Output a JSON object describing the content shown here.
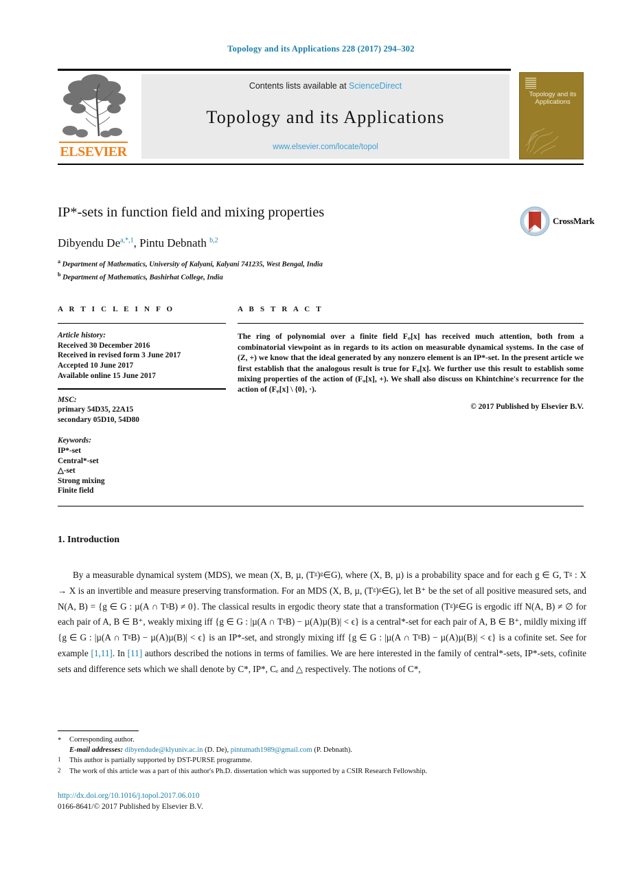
{
  "running_head": "Topology and its Applications 228 (2017) 294–302",
  "masthead": {
    "contents_prefix": "Contents lists available at ",
    "sciencedirect": "ScienceDirect",
    "journal_title": "Topology  and  its  Applications",
    "journal_url": "www.elsevier.com/locate/topol",
    "publisher_wordmark": "ELSEVIER",
    "cover_title": "Topology and its Applications"
  },
  "article": {
    "title": "IP*-sets in function field and mixing properties",
    "authors_line": "Dibyendu De",
    "author1_sups": "a,*,1",
    "author2_name": ", Pintu Debnath ",
    "author2_sups": "b,2",
    "affiliations": [
      {
        "mark": "a",
        "text": "Department of Mathematics, University of Kalyani, Kalyani 741235, West Bengal, India"
      },
      {
        "mark": "b",
        "text": "Department of Mathematics, Bashirhat College, India"
      }
    ],
    "crossmark_label": "CrossMark"
  },
  "info": {
    "heading": "A R T I C L E   I N F O",
    "history_label": "Article history:",
    "history": [
      "Received 30 December 2016",
      "Received in revised form 3 June 2017",
      "Accepted 10 June 2017",
      "Available online 15 June 2017"
    ],
    "msc_label": "MSC:",
    "msc": [
      "primary 54D35, 22A15",
      "secondary 05D10, 54D80"
    ],
    "keywords_label": "Keywords:",
    "keywords": [
      "IP*-set",
      "Central*-set",
      "△-set",
      "Strong mixing",
      "Finite field"
    ]
  },
  "abstract": {
    "heading": "A B S T R A C T",
    "body": "The ring of polynomial over a finite field Fᵩ[x] has received much attention, both from a combinatorial viewpoint as in regards to its action on measurable dynamical systems. In the case of (Z, +) we know that the ideal generated by any nonzero element is an IP*-set. In the present article we first establish that the analogous result is true for Fᵩ[x]. We further use this result to establish some mixing properties of the action of (Fᵩ[x], +). We shall also discuss on Khintchine's recurrence for the action of (Fᵩ[x] \\ {0}, ·).",
    "copyright": "© 2017 Published by Elsevier B.V."
  },
  "section": {
    "heading": "1.  Introduction",
    "paragraph_1": "By a measurable dynamical system (MDS), we mean (X, B, µ, (Tᵍ)ᵍ∈G), where (X, B, µ) is a probability space and for each g ∈ G, Tᵍ : X → X is an invertible and measure preserving transformation. For an MDS (X, B, µ, (Tᵍ)ᵍ∈G), let B⁺ be the set of all positive measured sets, and N(A, B) = {g ∈ G : µ(A ∩ TᵍB) ≠ 0}. The classical results in ergodic theory state that a transformation (Tᵍ)ᵍ∈G is ergodic iff N(A, B) ≠ ∅ for each pair of A, B ∈ B⁺, weakly mixing iff {g ∈ G : |µ(A ∩ TᵍB) − µ(A)µ(B)| < ϵ} is a central*-set for each pair of A, B ∈ B⁺, mildly mixing iff {g ∈ G : |µ(A ∩ TᵍB) − µ(A)µ(B)| < ϵ} is an IP*-set, and strongly mixing iff {g ∈ G : |µ(A ∩ TᵍB) − µ(A)µ(B)| < ϵ} is a cofinite set. See for example ",
    "ref_1": "[1,11]",
    "paragraph_mid": ". In ",
    "ref_2": "[11]",
    "paragraph_2": " authors described the notions in terms of families. We are here interested in the family of central*-sets, IP*-sets, cofinite sets and difference sets which we shall denote by C*, IP*, Cₑ and △ respectively. The notions of C*,"
  },
  "footnotes": {
    "corresponding": "Corresponding author.",
    "email_label": "E-mail addresses:",
    "email1": "dibyendude@klyuniv.ac.in",
    "email1_owner": " (D. De), ",
    "email2": "pintumath1989@gmail.com",
    "email2_owner": " (P. Debnath).",
    "note1_mark": "1",
    "note1": "This author is partially supported by DST-PURSE programme.",
    "note2_mark": "2",
    "note2": "The work of this article was a part of this author's Ph.D. dissertation which was supported by a CSIR Research Fellowship."
  },
  "doi": {
    "url": "http://dx.doi.org/10.1016/j.topol.2017.06.010",
    "issn_line": "0166-8641/© 2017 Published by Elsevier B.V."
  },
  "colors": {
    "link": "#1b7ea6",
    "sciencedirect": "#3a9fd6",
    "elsevier_orange": "#f08019",
    "cover_gold": "#9a7d28",
    "panel_grey": "#eaeaea"
  }
}
